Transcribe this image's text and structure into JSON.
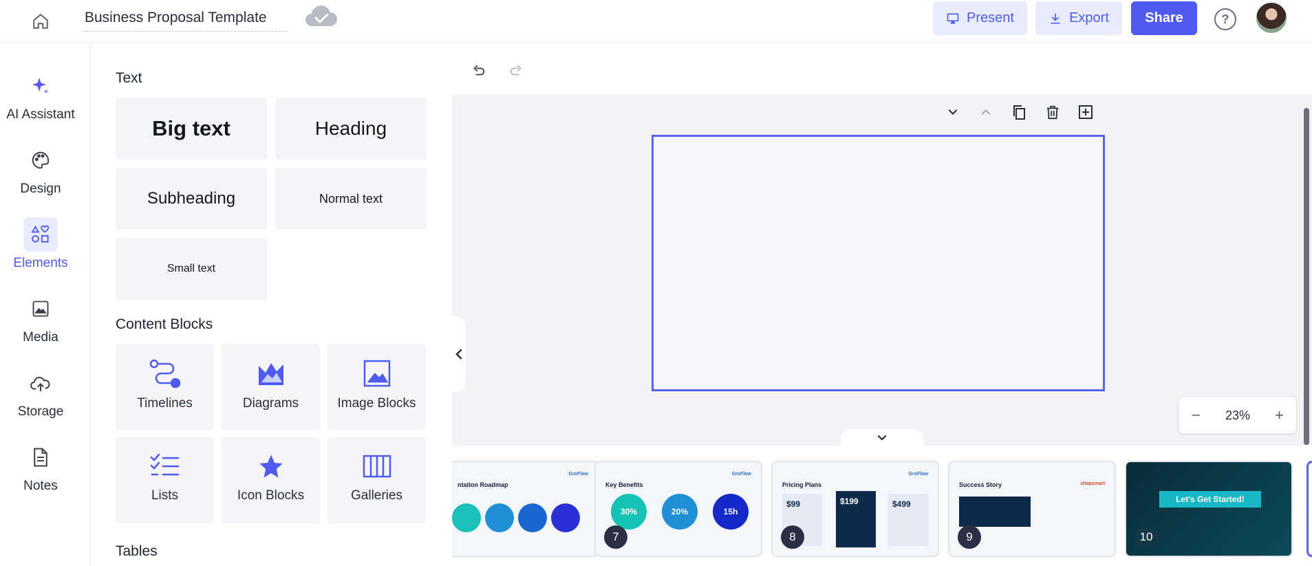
{
  "topbar": {
    "doc_title": "Business Proposal Template",
    "present_label": "Present",
    "export_label": "Export",
    "share_label": "Share",
    "help_label": "?"
  },
  "rail": {
    "items": [
      {
        "label": "AI Assistant",
        "icon": "sparkle-icon"
      },
      {
        "label": "Design",
        "icon": "palette-icon"
      },
      {
        "label": "Elements",
        "icon": "shapes-icon",
        "active": true
      },
      {
        "label": "Media",
        "icon": "image-icon"
      },
      {
        "label": "Storage",
        "icon": "cloud-upload-icon"
      },
      {
        "label": "Notes",
        "icon": "notes-icon"
      }
    ]
  },
  "panel": {
    "text_title": "Text",
    "text_items": [
      "Big text",
      "Heading",
      "Subheading",
      "Normal text",
      "Small text"
    ],
    "content_title": "Content Blocks",
    "content_items": [
      "Timelines",
      "Diagrams",
      "Image Blocks",
      "Lists",
      "Icon Blocks",
      "Galleries"
    ],
    "tables_title": "Tables"
  },
  "zoom": {
    "value": "23%",
    "minus": "−",
    "plus": "+"
  },
  "slides": [
    {
      "num": "",
      "title": "ntation Roadmap",
      "logo": "GroFlow"
    },
    {
      "num": "7",
      "title": "Key Benefits",
      "logo": "GroFlow",
      "stats": [
        "30%",
        "20%",
        "15h"
      ]
    },
    {
      "num": "8",
      "title": "Pricing Plans",
      "logo": "GroFlow",
      "prices": [
        "$99",
        "$199",
        "$499"
      ]
    },
    {
      "num": "9",
      "title": "Success Story",
      "logo": "shopsmart"
    },
    {
      "num": "10",
      "title": "Let's Get Started!"
    }
  ],
  "colors": {
    "accent": "#4f5bf0",
    "accent_light": "#e9ecfd",
    "frame": "#5864f0"
  }
}
